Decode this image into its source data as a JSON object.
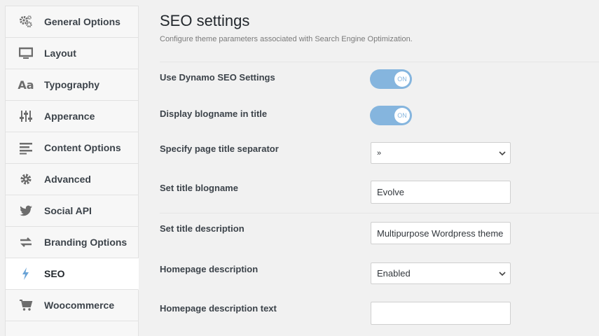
{
  "sidebar": {
    "items": [
      {
        "label": "General Options",
        "icon": "gears-icon"
      },
      {
        "label": "Layout",
        "icon": "monitor-icon"
      },
      {
        "label": "Typography",
        "icon": "typography-icon"
      },
      {
        "label": "Apperance",
        "icon": "sliders-icon"
      },
      {
        "label": "Content Options",
        "icon": "text-lines-icon"
      },
      {
        "label": "Advanced",
        "icon": "gear-icon"
      },
      {
        "label": "Social API",
        "icon": "twitter-icon"
      },
      {
        "label": "Branding Options",
        "icon": "arrows-icon"
      },
      {
        "label": "SEO",
        "icon": "bolt-icon",
        "active": true
      },
      {
        "label": "Woocommerce",
        "icon": "cart-icon"
      }
    ]
  },
  "main": {
    "title": "SEO settings",
    "subtitle": "Configure theme parameters associated with Search Engine Optimization.",
    "settings": [
      {
        "label": "Use Dynamo SEO Settings",
        "type": "toggle",
        "value": "ON"
      },
      {
        "label": "Display blogname in title",
        "type": "toggle",
        "value": "ON"
      },
      {
        "label": "Specify page title separator",
        "type": "select",
        "value": "»"
      },
      {
        "label": "Set title blogname",
        "type": "text",
        "value": "Evolve"
      },
      {
        "label": "Set title description",
        "type": "text",
        "value": "Multipurpose Wordpress theme"
      },
      {
        "label": "Homepage description",
        "type": "select",
        "value": "Enabled"
      },
      {
        "label": "Homepage description text",
        "type": "text",
        "value": ""
      }
    ]
  },
  "colors": {
    "accent": "#85b5de",
    "active_icon": "#6aa3d6"
  }
}
